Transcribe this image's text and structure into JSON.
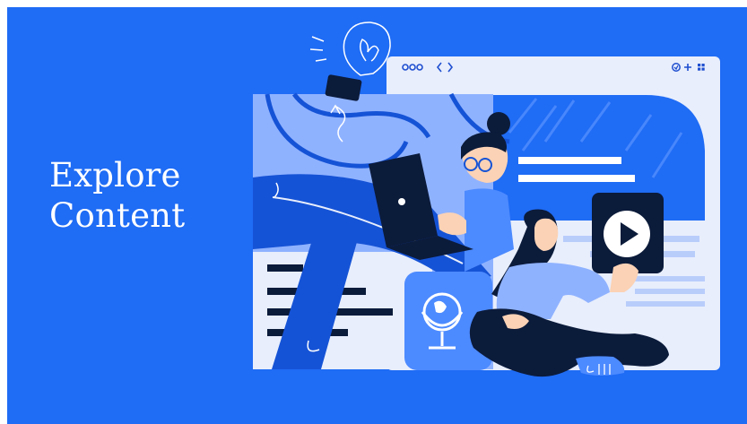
{
  "banner": {
    "headline_line1": "Explore",
    "headline_line2": "Content"
  },
  "icons": {
    "lightbulb": "lightbulb-icon",
    "play": "play-icon",
    "globe": "globe-icon",
    "laptop": "laptop-icon"
  },
  "colors": {
    "banner_background": "#1f6cf5",
    "browser_window": "#e8eefc",
    "panel_blue": "#8fb2ff",
    "dark_navy": "#0b1b3a"
  }
}
